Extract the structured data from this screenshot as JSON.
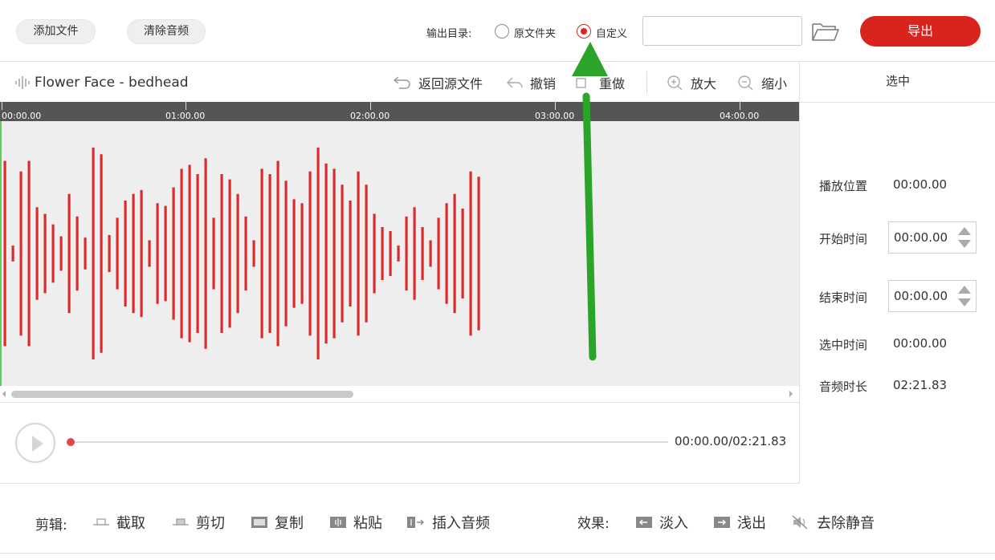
{
  "topbar": {
    "add_file": "添加文件",
    "clear_audio": "清除音频",
    "output_dir_label": "输出目录:",
    "radio_source": "原文件夹",
    "radio_custom": "自定义",
    "selected_radio": "custom",
    "path_value": "",
    "export": "导出"
  },
  "toolbar": {
    "file_name": "Flower Face - bedhead",
    "revert": "返回源文件",
    "undo": "撤销",
    "redo": "重做",
    "zoom_in": "放大",
    "zoom_out": "缩小"
  },
  "timeline": {
    "ticks": [
      "00:00.00",
      "01:00.00",
      "02:00.00",
      "03:00.00",
      "04:00.00"
    ],
    "wave_color": "#e02a2a",
    "playhead_color": "#5ad05a"
  },
  "panel": {
    "title": "选中",
    "play_position_label": "播放位置",
    "play_position_value": "00:00.00",
    "start_label": "开始时间",
    "start_value": "00:00.00",
    "end_label": "结束时间",
    "end_value": "00:00.00",
    "selected_label": "选中时间",
    "selected_value": "00:00.00",
    "duration_label": "音频时长",
    "duration_value": "02:21.83"
  },
  "player": {
    "time": "00:00.00/02:21.83",
    "progress": 0
  },
  "edit": {
    "label": "剪辑:",
    "trim": "截取",
    "cut": "剪切",
    "copy": "复制",
    "paste": "粘贴",
    "insert": "插入音频",
    "effects_label": "效果:",
    "fade_in": "淡入",
    "fade_out": "浅出",
    "remove_silence": "去除静音"
  },
  "colors": {
    "accent": "#d9231d",
    "ruler": "#555555",
    "wave_bg": "#eeeeee"
  }
}
